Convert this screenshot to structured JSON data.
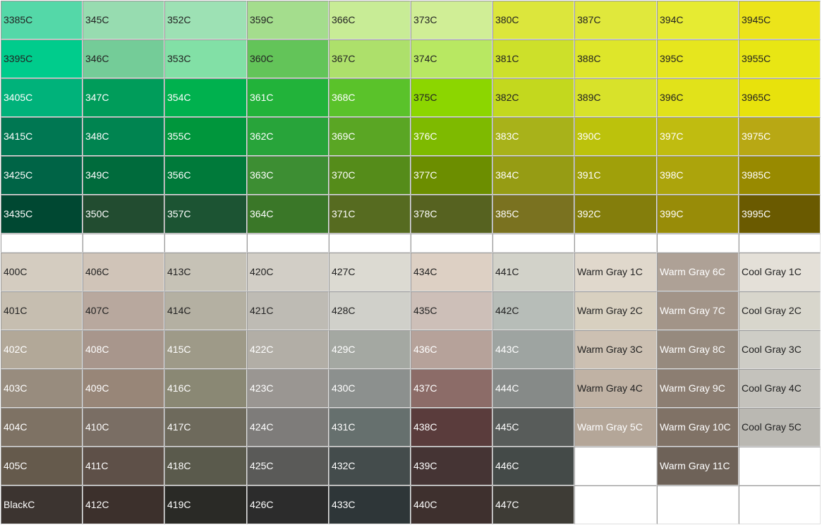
{
  "swatch_chart": {
    "groups": [
      {
        "rows": [
          [
            {
              "label": "3385C",
              "color": "#54d8a8",
              "text": "#222"
            },
            {
              "label": "345C",
              "color": "#97dcb0",
              "text": "#222"
            },
            {
              "label": "352C",
              "color": "#9de1b4",
              "text": "#222"
            },
            {
              "label": "359C",
              "color": "#a4dd8d",
              "text": "#222"
            },
            {
              "label": "366C",
              "color": "#c8ec96",
              "text": "#222"
            },
            {
              "label": "373C",
              "color": "#d0ee96",
              "text": "#222"
            },
            {
              "label": "380C",
              "color": "#dce63c",
              "text": "#222"
            },
            {
              "label": "387C",
              "color": "#e0e83c",
              "text": "#222"
            },
            {
              "label": "394C",
              "color": "#e6eb32",
              "text": "#222"
            },
            {
              "label": "3945C",
              "color": "#ece41a",
              "text": "#222"
            }
          ],
          [
            {
              "label": "3395C",
              "color": "#00cc8c",
              "text": "#222"
            },
            {
              "label": "346C",
              "color": "#74cc98",
              "text": "#222"
            },
            {
              "label": "353C",
              "color": "#82e0a6",
              "text": "#222"
            },
            {
              "label": "360C",
              "color": "#63c459",
              "text": "#222"
            },
            {
              "label": "367C",
              "color": "#ade06b",
              "text": "#222"
            },
            {
              "label": "374C",
              "color": "#b8e862",
              "text": "#222"
            },
            {
              "label": "381C",
              "color": "#cde02a",
              "text": "#222"
            },
            {
              "label": "388C",
              "color": "#dee62a",
              "text": "#222"
            },
            {
              "label": "395C",
              "color": "#e6e61e",
              "text": "#222"
            },
            {
              "label": "3955C",
              "color": "#e8e614",
              "text": "#222"
            }
          ],
          [
            {
              "label": "3405C",
              "color": "#00b27a",
              "text": "#fff"
            },
            {
              "label": "347C",
              "color": "#009c5a",
              "text": "#fff"
            },
            {
              "label": "354C",
              "color": "#00b14e",
              "text": "#fff"
            },
            {
              "label": "361C",
              "color": "#22b33a",
              "text": "#fff"
            },
            {
              "label": "368C",
              "color": "#5ac22a",
              "text": "#fff"
            },
            {
              "label": "375C",
              "color": "#8cd600",
              "text": "#222"
            },
            {
              "label": "382C",
              "color": "#c3d81e",
              "text": "#222"
            },
            {
              "label": "389C",
              "color": "#d8e22a",
              "text": "#222"
            },
            {
              "label": "396C",
              "color": "#e1e21a",
              "text": "#222"
            },
            {
              "label": "3965C",
              "color": "#e8e20c",
              "text": "#222"
            }
          ],
          [
            {
              "label": "3415C",
              "color": "#007752",
              "text": "#fff"
            },
            {
              "label": "348C",
              "color": "#008450",
              "text": "#fff"
            },
            {
              "label": "355C",
              "color": "#00963c",
              "text": "#fff"
            },
            {
              "label": "362C",
              "color": "#28a43a",
              "text": "#fff"
            },
            {
              "label": "369C",
              "color": "#5aa624",
              "text": "#fff"
            },
            {
              "label": "376C",
              "color": "#7eba00",
              "text": "#fff"
            },
            {
              "label": "383C",
              "color": "#a8b21a",
              "text": "#fff"
            },
            {
              "label": "390C",
              "color": "#bcc20c",
              "text": "#fff"
            },
            {
              "label": "397C",
              "color": "#c0bc10",
              "text": "#fff"
            },
            {
              "label": "3975C",
              "color": "#b8a814",
              "text": "#fff"
            }
          ],
          [
            {
              "label": "3425C",
              "color": "#006446",
              "text": "#fff"
            },
            {
              "label": "349C",
              "color": "#006b3c",
              "text": "#fff"
            },
            {
              "label": "356C",
              "color": "#007a3a",
              "text": "#fff"
            },
            {
              "label": "363C",
              "color": "#3d8e33",
              "text": "#fff"
            },
            {
              "label": "370C",
              "color": "#558c1a",
              "text": "#fff"
            },
            {
              "label": "377C",
              "color": "#6c8e00",
              "text": "#fff"
            },
            {
              "label": "384C",
              "color": "#969c14",
              "text": "#fff"
            },
            {
              "label": "391C",
              "color": "#a0a00a",
              "text": "#fff"
            },
            {
              "label": "398C",
              "color": "#aca40c",
              "text": "#fff"
            },
            {
              "label": "3985C",
              "color": "#988a00",
              "text": "#fff"
            }
          ],
          [
            {
              "label": "3435C",
              "color": "#004832",
              "text": "#fff"
            },
            {
              "label": "350C",
              "color": "#224c30",
              "text": "#fff"
            },
            {
              "label": "357C",
              "color": "#1c5433",
              "text": "#fff"
            },
            {
              "label": "364C",
              "color": "#3a7728",
              "text": "#fff"
            },
            {
              "label": "371C",
              "color": "#566b20",
              "text": "#fff"
            },
            {
              "label": "378C",
              "color": "#566220",
              "text": "#fff"
            },
            {
              "label": "385C",
              "color": "#7a7220",
              "text": "#fff"
            },
            {
              "label": "392C",
              "color": "#847e0c",
              "text": "#fff"
            },
            {
              "label": "399C",
              "color": "#988c08",
              "text": "#fff"
            },
            {
              "label": "3995C",
              "color": "#6a5a00",
              "text": "#fff"
            }
          ]
        ]
      },
      {
        "rows": [
          [
            {
              "label": "400C",
              "color": "#d4ccc0",
              "text": "#222"
            },
            {
              "label": "406C",
              "color": "#d0c4b8",
              "text": "#222"
            },
            {
              "label": "413C",
              "color": "#c6c2b6",
              "text": "#222"
            },
            {
              "label": "420C",
              "color": "#d2cec6",
              "text": "#222"
            },
            {
              "label": "427C",
              "color": "#dcdad2",
              "text": "#222"
            },
            {
              "label": "434C",
              "color": "#ddd0c4",
              "text": "#222"
            },
            {
              "label": "441C",
              "color": "#d2d2c9",
              "text": "#222"
            },
            {
              "label": "Warm Gray 1C",
              "color": "#e0d8cc",
              "text": "#222"
            },
            {
              "label": "Warm Gray 6C",
              "color": "#aea196",
              "text": "#fff"
            },
            {
              "label": "Cool Gray 1C",
              "color": "#e4e0d8",
              "text": "#222"
            }
          ],
          [
            {
              "label": "401C",
              "color": "#c6beb0",
              "text": "#222"
            },
            {
              "label": "407C",
              "color": "#b8a89e",
              "text": "#222"
            },
            {
              "label": "414C",
              "color": "#b4b0a2",
              "text": "#222"
            },
            {
              "label": "421C",
              "color": "#bebbb4",
              "text": "#222"
            },
            {
              "label": "428C",
              "color": "#d0d0ca",
              "text": "#222"
            },
            {
              "label": "435C",
              "color": "#cdbfb8",
              "text": "#222"
            },
            {
              "label": "442C",
              "color": "#b7bdb8",
              "text": "#222"
            },
            {
              "label": "Warm Gray 2C",
              "color": "#d8d0c0",
              "text": "#222"
            },
            {
              "label": "Warm Gray 7C",
              "color": "#a29488",
              "text": "#fff"
            },
            {
              "label": "Cool Gray 2C",
              "color": "#d8d6cc",
              "text": "#222"
            }
          ],
          [
            {
              "label": "402C",
              "color": "#b2a898",
              "text": "#fff"
            },
            {
              "label": "408C",
              "color": "#a8968c",
              "text": "#fff"
            },
            {
              "label": "415C",
              "color": "#9e9a88",
              "text": "#fff"
            },
            {
              "label": "422C",
              "color": "#b2aea6",
              "text": "#fff"
            },
            {
              "label": "429C",
              "color": "#a4a8a2",
              "text": "#fff"
            },
            {
              "label": "436C",
              "color": "#b6a29a",
              "text": "#fff"
            },
            {
              "label": "443C",
              "color": "#9ea4a1",
              "text": "#fff"
            },
            {
              "label": "Warm Gray 3C",
              "color": "#ccc0b2",
              "text": "#222"
            },
            {
              "label": "Warm Gray 8C",
              "color": "#968a7e",
              "text": "#fff"
            },
            {
              "label": "Cool Gray 3C",
              "color": "#cecdc6",
              "text": "#222"
            }
          ],
          [
            {
              "label": "403C",
              "color": "#988c7e",
              "text": "#fff"
            },
            {
              "label": "409C",
              "color": "#988678",
              "text": "#fff"
            },
            {
              "label": "416C",
              "color": "#8a8874",
              "text": "#fff"
            },
            {
              "label": "423C",
              "color": "#9a9692",
              "text": "#fff"
            },
            {
              "label": "430C",
              "color": "#8c908e",
              "text": "#fff"
            },
            {
              "label": "437C",
              "color": "#8c6c68",
              "text": "#fff"
            },
            {
              "label": "444C",
              "color": "#868a88",
              "text": "#fff"
            },
            {
              "label": "Warm Gray 4C",
              "color": "#c0b2a4",
              "text": "#222"
            },
            {
              "label": "Warm Gray 9C",
              "color": "#8c7e72",
              "text": "#fff"
            },
            {
              "label": "Cool Gray 4C",
              "color": "#c4c2bc",
              "text": "#222"
            }
          ],
          [
            {
              "label": "404C",
              "color": "#7e7264",
              "text": "#fff"
            },
            {
              "label": "410C",
              "color": "#7a6e64",
              "text": "#fff"
            },
            {
              "label": "417C",
              "color": "#6e6a5c",
              "text": "#fff"
            },
            {
              "label": "424C",
              "color": "#7e7c7a",
              "text": "#fff"
            },
            {
              "label": "431C",
              "color": "#66706e",
              "text": "#fff"
            },
            {
              "label": "438C",
              "color": "#5a3c3c",
              "text": "#fff"
            },
            {
              "label": "445C",
              "color": "#585c5a",
              "text": "#fff"
            },
            {
              "label": "Warm Gray 5C",
              "color": "#b4a698",
              "text": "#fff"
            },
            {
              "label": "Warm Gray 10C",
              "color": "#807266",
              "text": "#fff"
            },
            {
              "label": "Cool Gray 5C",
              "color": "#bab8b2",
              "text": "#222"
            }
          ],
          [
            {
              "label": "405C",
              "color": "#655a4c",
              "text": "#fff"
            },
            {
              "label": "411C",
              "color": "#5e5048",
              "text": "#fff"
            },
            {
              "label": "418C",
              "color": "#5a5a4c",
              "text": "#fff"
            },
            {
              "label": "425C",
              "color": "#5a5a58",
              "text": "#fff"
            },
            {
              "label": "432C",
              "color": "#444c4c",
              "text": "#fff"
            },
            {
              "label": "439C",
              "color": "#453434",
              "text": "#fff"
            },
            {
              "label": "446C",
              "color": "#444a48",
              "text": "#fff"
            },
            {
              "label": "",
              "color": "#ffffff",
              "text": "#222"
            },
            {
              "label": "Warm Gray 11C",
              "color": "#6e6258",
              "text": "#fff"
            },
            {
              "label": "",
              "color": "#ffffff",
              "text": "#222"
            }
          ],
          [
            {
              "label": "BlackC",
              "color": "#3c3430",
              "text": "#fff"
            },
            {
              "label": "412C",
              "color": "#3c302c",
              "text": "#fff"
            },
            {
              "label": "419C",
              "color": "#2a2a26",
              "text": "#fff"
            },
            {
              "label": "426C",
              "color": "#2c2c2c",
              "text": "#fff"
            },
            {
              "label": "433C",
              "color": "#2e3638",
              "text": "#fff"
            },
            {
              "label": "440C",
              "color": "#3e302e",
              "text": "#fff"
            },
            {
              "label": "447C",
              "color": "#3e3c36",
              "text": "#fff"
            },
            {
              "label": "",
              "color": "#ffffff",
              "text": "#222"
            },
            {
              "label": "",
              "color": "#ffffff",
              "text": "#222"
            },
            {
              "label": "",
              "color": "#ffffff",
              "text": "#222"
            }
          ]
        ]
      }
    ]
  }
}
